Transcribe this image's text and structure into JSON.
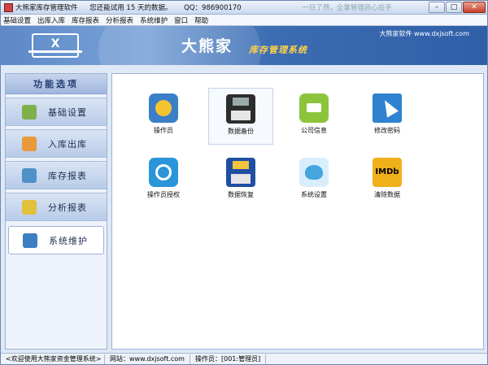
{
  "window": {
    "title": "大熊家库存管理软件",
    "trial": "您还能试用 15 天的数据。",
    "qq": "QQ：986900170",
    "marquee": "一日了然，全掌管理商心应手",
    "buttons": {
      "minimize": "–",
      "maximize": "□",
      "close": "✕"
    }
  },
  "menu": [
    "基础设置",
    "出库入库",
    "库存报表",
    "分析报表",
    "系统维护",
    "窗口",
    "帮助"
  ],
  "banner": {
    "logo_letter": "X",
    "brand": "大熊家",
    "subtitle": "库存管理系统",
    "site": "大熊家软件 www.dxjsoft.com"
  },
  "sidebar": {
    "header": "功能选项",
    "items": [
      {
        "label": "基础设置",
        "icon": "settings-icon",
        "color": "#7fb14a",
        "active": false
      },
      {
        "label": "入库出库",
        "icon": "box-icon",
        "color": "#e89a3c",
        "active": false
      },
      {
        "label": "库存报表",
        "icon": "stack-icon",
        "color": "#4e90c8",
        "active": false
      },
      {
        "label": "分析报表",
        "icon": "chart-icon",
        "color": "#e1c13b",
        "active": false
      },
      {
        "label": "系统维护",
        "icon": "maintenance-icon",
        "color": "#3c7fc2",
        "active": true
      }
    ]
  },
  "tiles": [
    {
      "label": "操作员",
      "icon": "operator-icon",
      "color": "#3a7fc8"
    },
    {
      "label": "数据备份",
      "icon": "floppy-icon",
      "color": "#2d2d2d",
      "selected": true
    },
    {
      "label": "公司信息",
      "icon": "company-icon",
      "color": "#8cc43c"
    },
    {
      "label": "修改密码",
      "icon": "cursor-icon",
      "color": "#2f82d0"
    },
    {
      "label": "操作员授权",
      "icon": "authorize-icon",
      "color": "#2a95d8"
    },
    {
      "label": "数据恢复",
      "icon": "restore-icon",
      "color": "#1f4fa3"
    },
    {
      "label": "系统设置",
      "icon": "bird-icon",
      "color": "#45a6df"
    },
    {
      "label": "清除数据",
      "icon": "clear-icon",
      "color": "#f0b019",
      "text": "IMDb"
    }
  ],
  "status": {
    "welcome": "<欢迎使用大熊家资金管理系统>",
    "website": "网站：www.dxjsoft.com",
    "operator": "操作员：[001:管理员]"
  }
}
